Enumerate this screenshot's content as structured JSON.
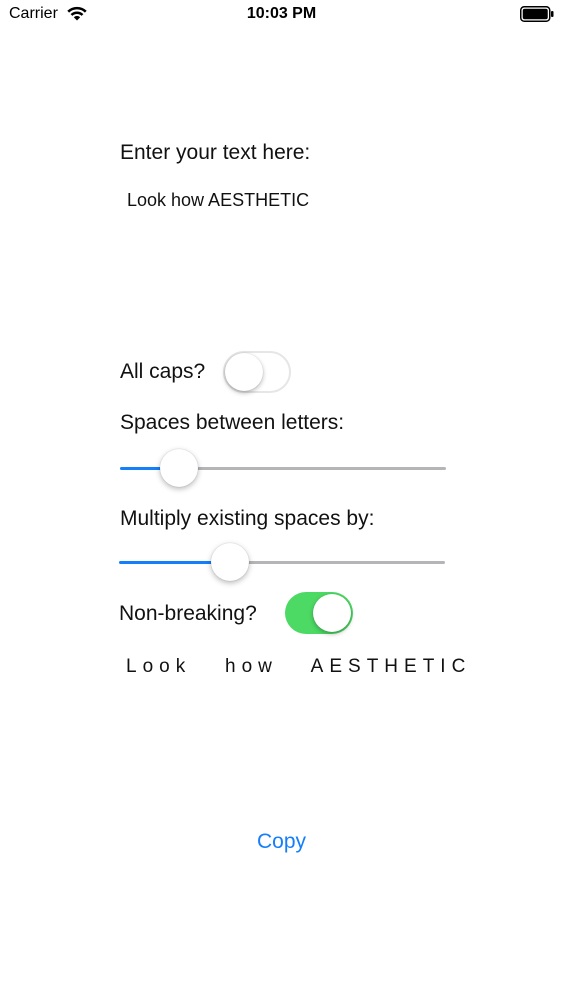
{
  "status_bar": {
    "carrier": "Carrier",
    "time": "10:03 PM",
    "wifi_icon": "wifi-icon",
    "battery_icon": "battery-icon"
  },
  "form": {
    "input_label": "Enter your text here:",
    "input_value": "Look how AESTHETIC",
    "all_caps_label": "All caps?",
    "all_caps_on": false,
    "spaces_label": "Spaces between letters:",
    "spaces_slider_fraction": 0.14,
    "multiply_label": "Multiply existing spaces by:",
    "multiply_slider_fraction": 0.32,
    "non_breaking_label": "Non-breaking?",
    "non_breaking_on": true
  },
  "output_text": "Look   how   AESTHETIC",
  "copy_label": "Copy",
  "colors": {
    "accent": "#147efb",
    "switch_on": "#4cd964",
    "track_max": "#b5b5b8"
  }
}
